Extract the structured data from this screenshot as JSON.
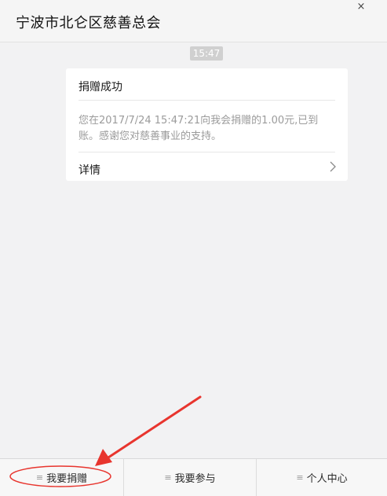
{
  "header": {
    "title": "宁波市北仑区慈善总会",
    "close_symbol": "×"
  },
  "chat": {
    "timestamp": "15:47",
    "card": {
      "title": "捐赠成功",
      "body": "您在2017/7/24 15:47:21向我会捐赠的1.00元,已到账。感谢您对慈善事业的支持。",
      "detail_label": "详情"
    }
  },
  "footer": {
    "menu_icon": "≡",
    "tabs": [
      {
        "label": "我要捐赠"
      },
      {
        "label": "我要参与"
      },
      {
        "label": "个人中心"
      }
    ]
  },
  "colors": {
    "annotation": "#e8352e",
    "background": "#f2f2f3",
    "card": "#ffffff",
    "muted_text": "#9b9b9b"
  },
  "icons": {
    "close": "close-icon",
    "chevron": "chevron-right-icon",
    "menu": "menu-icon"
  }
}
